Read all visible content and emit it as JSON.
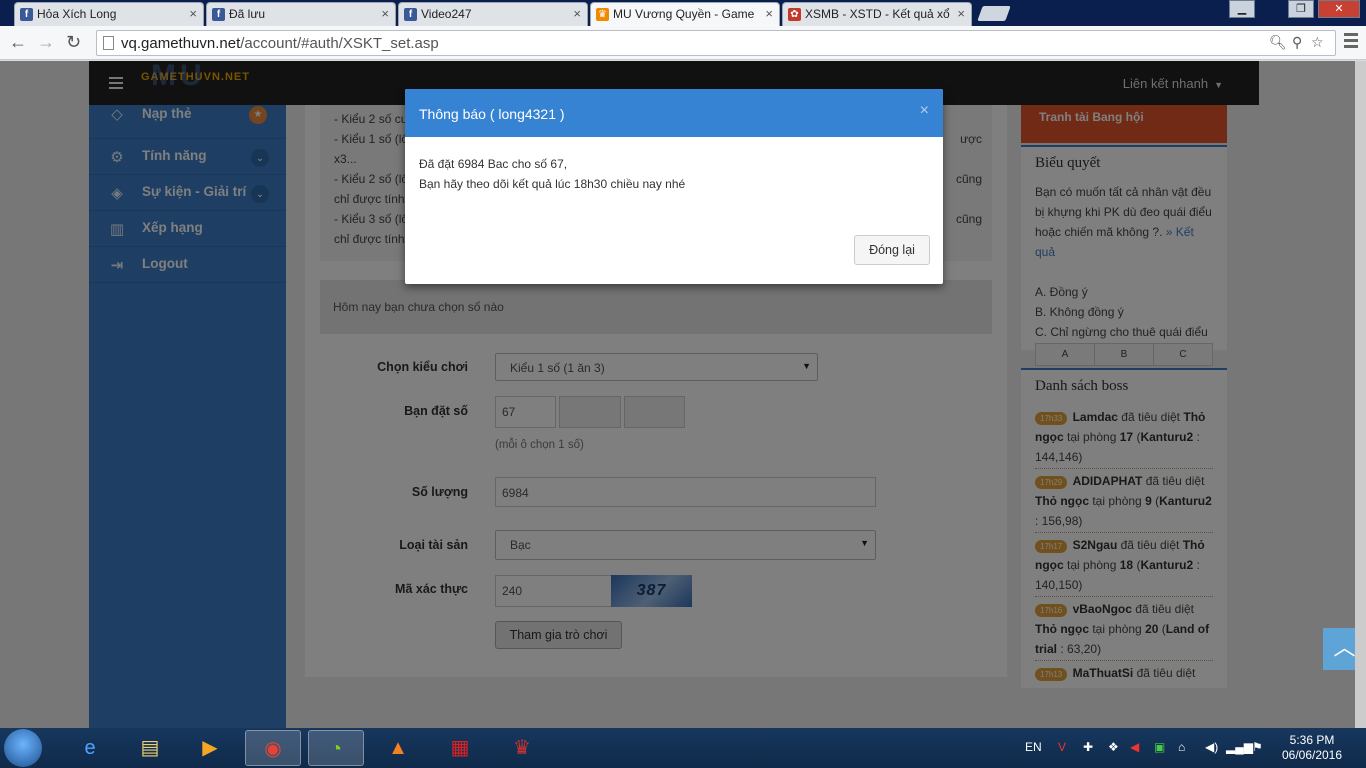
{
  "browser": {
    "tabs": [
      {
        "title": "Hỏa Xích Long",
        "icon": "facebook-icon"
      },
      {
        "title": "Đã lưu",
        "icon": "facebook-icon"
      },
      {
        "title": "Video247",
        "icon": "facebook-icon"
      },
      {
        "title": "MU Vương Quyền - Game",
        "icon": "mu-icon",
        "active": true
      },
      {
        "title": "XSMB - XSTD - Kết quả xổ",
        "icon": "xsmb-icon"
      }
    ],
    "url_host": "vq.gamethuvn.net",
    "url_path": "/account/#auth/XSKT_set.asp"
  },
  "header": {
    "logo_text": "GAMETHUVN.NET",
    "logo_big": "MU",
    "quick_links": "Liên kết nhanh"
  },
  "sidebar": {
    "items": [
      {
        "label": "Nạp thẻ",
        "icon": "diamond-icon",
        "badge": "★"
      },
      {
        "label": "Tính năng",
        "icon": "gears-icon",
        "chevron": "⌄"
      },
      {
        "label": "Sự kiện - Giải trí",
        "icon": "events-icon",
        "chevron": "⌄"
      },
      {
        "label": "Xếp hạng",
        "icon": "bar-chart-icon"
      },
      {
        "label": "Logout",
        "icon": "logout-icon"
      }
    ]
  },
  "rules": {
    "lines": [
      {
        "left": "- Kiểu 2 số cu",
        "right": ""
      },
      {
        "left": "- Kiểu 1 số (lô",
        "right": "ược"
      },
      {
        "left": "x3...",
        "right": ""
      },
      {
        "left": "- Kiểu 2 số (lô",
        "right": "cũng"
      },
      {
        "left": "chỉ được tính",
        "right": ""
      },
      {
        "left": "- Kiểu 3 số (lô",
        "right": "cũng"
      },
      {
        "left": "chỉ được tính",
        "right": ""
      }
    ]
  },
  "notice": "Hôm nay bạn chưa chọn số nào",
  "form": {
    "play_type_label": "Chọn kiểu chơi",
    "play_type_value": "Kiểu 1 số (1 ăn 3)",
    "bet_number_label": "Bạn đặt số",
    "bet_number_1": "67",
    "bet_number_hint": "(mỗi ô chọn 1 số)",
    "quantity_label": "Số lượng",
    "quantity_value": "6984",
    "asset_label": "Loại tài sản",
    "asset_value": "Bạc",
    "captcha_label": "Mã xác thực",
    "captcha_value": "240",
    "captcha_image_text": "387",
    "submit_label": "Tham gia trò chơi"
  },
  "right": {
    "banner": "Tranh tài Bang hội",
    "poll": {
      "title": "Biểu quyết",
      "question": "Bạn có muốn tất cả nhân vật đều bị khựng khi PK dù đeo quái điểu hoặc chiến mã không ?.",
      "result_link": "» Kết quả",
      "options": [
        "A. Đồng ý",
        "B. Không đồng ý",
        "C. Chỉ ngừng cho thuê quái điểu"
      ],
      "buttons": [
        "A",
        "B",
        "C"
      ]
    },
    "boss": {
      "title": "Danh sách boss",
      "entries": [
        {
          "time": "17h33",
          "player": "Lamdac",
          "action": "đã tiêu diệt",
          "boss": "Thỏ ngọc",
          "room_prefix": "tại phòng",
          "room": "17",
          "map": "Kanturu2",
          "coords": "144,146"
        },
        {
          "time": "17h29",
          "player": "ADIDAPHAT",
          "action": "đã tiêu diệt",
          "boss": "Thỏ ngọc",
          "room_prefix": "tại phòng",
          "room": "9",
          "map": "Kanturu2",
          "coords": "156,98"
        },
        {
          "time": "17h17",
          "player": "S2Ngau",
          "action": "đã tiêu diệt",
          "boss": "Thỏ ngọc",
          "room_prefix": "tại phòng",
          "room": "18",
          "map": "Kanturu2",
          "coords": "140,150"
        },
        {
          "time": "17h16",
          "player": "vBaoNgoc",
          "action": "đã tiêu diệt",
          "boss": "Thỏ ngọc",
          "room_prefix": "tại phòng",
          "room": "20",
          "map": "Land of trial",
          "coords": "63,20"
        },
        {
          "time": "17h13",
          "player": "MaThuatSi",
          "action": "đã tiêu diệt",
          "boss": "",
          "room_prefix": "",
          "room": "",
          "map": "",
          "coords": ""
        }
      ]
    }
  },
  "modal": {
    "title": "Thông báo ( long4321 )",
    "line1": "Đã đặt 6984 Bac cho số 67,",
    "line2": "Bạn hãy theo dõi kết quả lúc 18h30 chiều nay nhé",
    "close_button": "Đóng lại",
    "close_x": "×"
  },
  "taskbar": {
    "lang": "EN",
    "time": "5:36 PM",
    "date": "06/06/2016"
  },
  "colors": {
    "accent_blue": "#3d7fc6",
    "modal_header": "#3783d3",
    "banner_orange": "#e0552d"
  }
}
